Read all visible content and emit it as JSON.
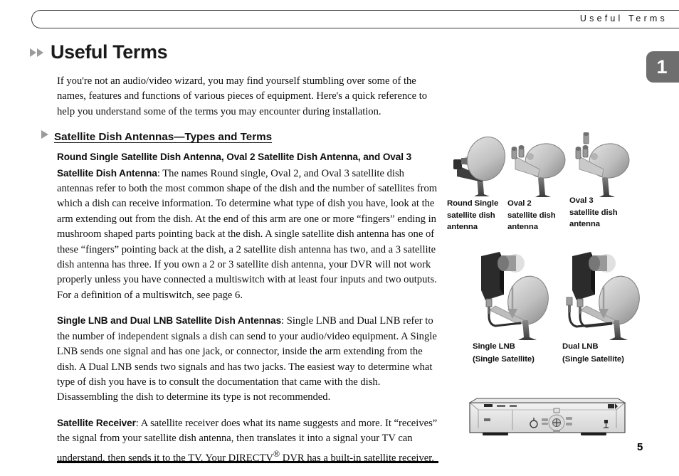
{
  "header": {
    "running_title": "Useful Terms"
  },
  "chapter_tab": {
    "number": "1"
  },
  "title": {
    "text": "Useful Terms",
    "bullet_icon": "double-triangle-right-icon"
  },
  "intro": {
    "paragraph": "If you're not an audio/video wizard, you may find yourself stumbling over some of the names, features and functions of various pieces of equipment. Here's a quick reference to help you understand some of the terms you may encounter during installation."
  },
  "subheading": {
    "text": "Satellite Dish Antennas—Types and Terms",
    "bullet_icon": "triangle-right-icon"
  },
  "sections": [
    {
      "run_in": "Round Single Satellite Dish Antenna, Oval 2 Satellite Dish Antenna, and Oval 3 Satellite Dish Antenna",
      "body": ": The names Round single, Oval 2, and Oval 3 satellite dish antennas refer to both the most common shape of the dish and the number of satellites from which a dish can receive information. To determine what type of dish you have, look at the arm extending out from the dish. At the end of this arm are one or more “fingers” ending in mushroom shaped parts pointing back at the dish. A single satellite dish antenna has one of these “fingers” pointing back at the dish, a 2 satellite dish antenna has two, and a 3 satellite dish antenna has three. If you own a 2 or 3 satellite dish antenna, your DVR will not work properly unless you have connected a multiswitch with at least four inputs and two outputs. For a definition of a multiswitch, see page 6."
    },
    {
      "run_in": "Single LNB and Dual LNB Satellite Dish Antennas",
      "body": ": Single LNB and Dual LNB refer to the number of independent signals a dish can send to your audio/video equipment. A Single LNB sends one signal and has one jack, or connector, inside the arm extending from the dish. A Dual LNB sends two signals and has two jacks. The easiest way to determine what type of dish you have is to consult the documentation that came with the dish. Disassembling the dish to determine its type is not recommended."
    },
    {
      "run_in": "Satellite Receiver",
      "body_pre": ": A satellite receiver does what its name suggests and more. It “receives” the signal from your satellite dish antenna, then translates it into a signal your TV can understand, then sends it to the TV. Your DIRECTV",
      "superscript": "®",
      "body_post": " DVR has a built-in satellite receiver."
    }
  ],
  "figures": {
    "dish_types": [
      {
        "caption": "Round Single\nsatellite dish\nantenna",
        "name": "round-single-dish"
      },
      {
        "caption": "Oval 2\nsatellite dish\nantenna",
        "name": "oval-2-dish"
      },
      {
        "caption": "Oval 3\nsatellite dish\nantenna",
        "name": "oval-3-dish"
      }
    ],
    "lnb_types": [
      {
        "caption": "Single LNB\n(Single Satellite)",
        "name": "single-lnb"
      },
      {
        "caption": "Dual LNB\n(Single Satellite)",
        "name": "dual-lnb"
      }
    ],
    "receiver": {
      "name": "satellite-receiver-front-panel"
    }
  },
  "page_number": "5",
  "colors": {
    "tab_gray": "#6e6e6e",
    "bullet_gray": "#9b9b9b",
    "dish_light": "#d9d9d9",
    "dish_dark": "#8f8f8f",
    "mount_dark": "#4a4a4a",
    "lnb_black": "#2b2b2b"
  }
}
